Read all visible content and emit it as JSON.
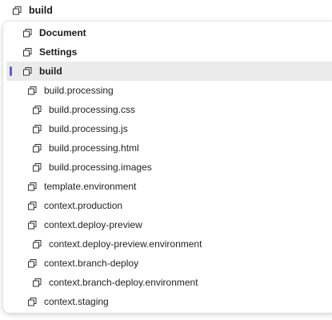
{
  "header": {
    "title": "build",
    "icon": "window-restore-icon"
  },
  "menu": {
    "icon": "window-restore-icon",
    "selected_color": "#5b5fc7",
    "items": [
      {
        "label": "Document",
        "level": 0,
        "bold": true
      },
      {
        "label": "Settings",
        "level": 0,
        "bold": true
      },
      {
        "label": "build",
        "level": 0,
        "bold": true,
        "selected": true
      },
      {
        "label": "build.processing",
        "level": 1
      },
      {
        "label": "build.processing.css",
        "level": 2
      },
      {
        "label": "build.processing.js",
        "level": 2
      },
      {
        "label": "build.processing.html",
        "level": 2
      },
      {
        "label": "build.processing.images",
        "level": 2
      },
      {
        "label": "template.environment",
        "level": 1
      },
      {
        "label": "context.production",
        "level": 1
      },
      {
        "label": "context.deploy-preview",
        "level": 1
      },
      {
        "label": "context.deploy-preview.environment",
        "level": 2
      },
      {
        "label": "context.branch-deploy",
        "level": 1
      },
      {
        "label": "context.branch-deploy.environment",
        "level": 2
      },
      {
        "label": "context.staging",
        "level": 1
      }
    ]
  }
}
